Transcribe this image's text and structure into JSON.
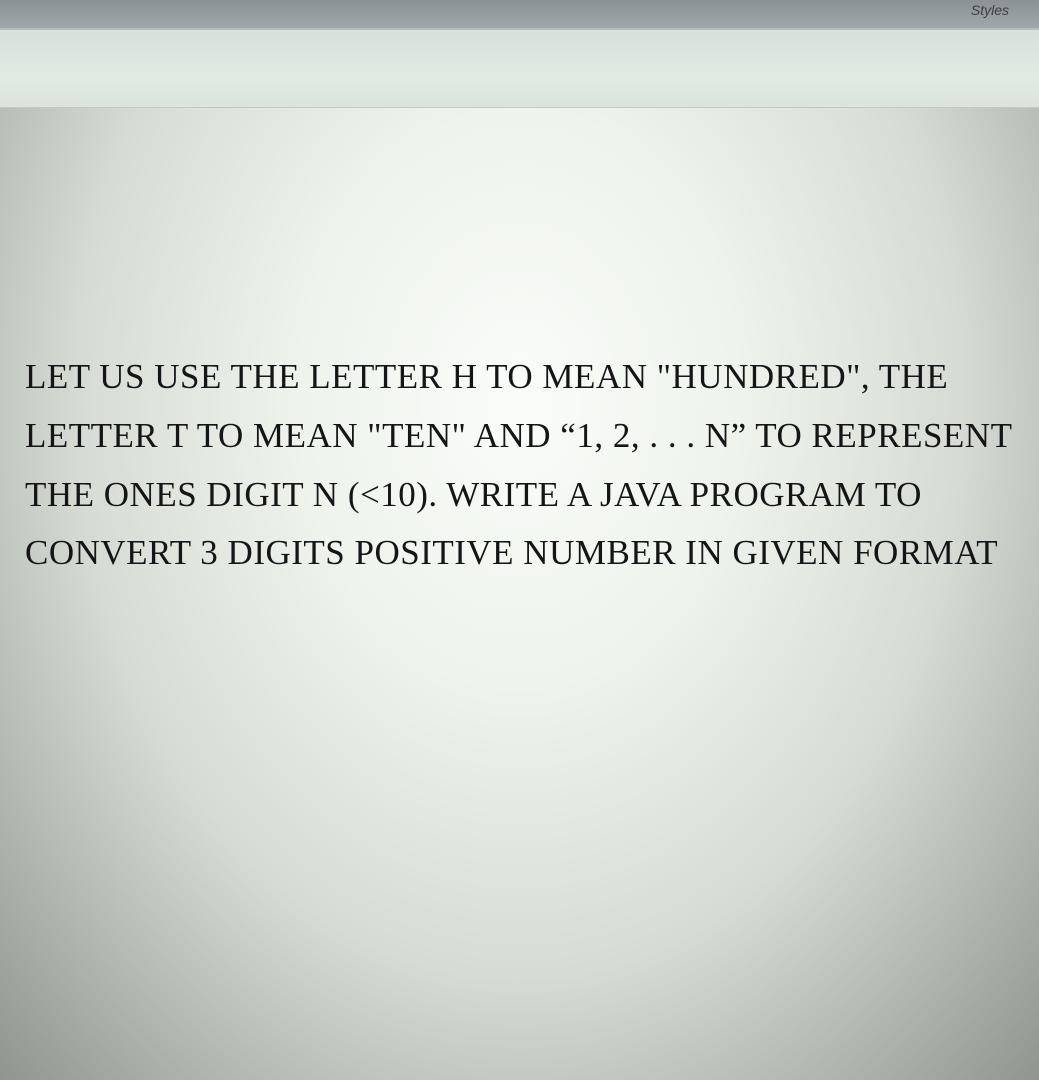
{
  "ribbon": {
    "group_label": "Styles"
  },
  "document": {
    "body_text": "LET US USE THE LETTER H TO MEAN \"HUNDRED\", THE LETTER T TO MEAN \"TEN\" AND “1, 2, . . . N” TO REPRESENT THE ONES DIGIT N (<10). WRITE A JAVA PROGRAM TO CONVERT 3 DIGITS POSITIVE NUMBER IN GIVEN FORMAT"
  }
}
